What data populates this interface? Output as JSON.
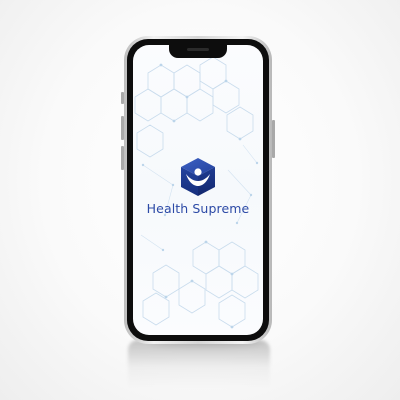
{
  "app": {
    "brand_name": "Health Supreme",
    "logo_icon": "hexagon-person-logo"
  },
  "colors": {
    "brand_blue": "#2c4aa6",
    "logo_dark": "#1f3a8f",
    "pattern": "#c9dced"
  }
}
